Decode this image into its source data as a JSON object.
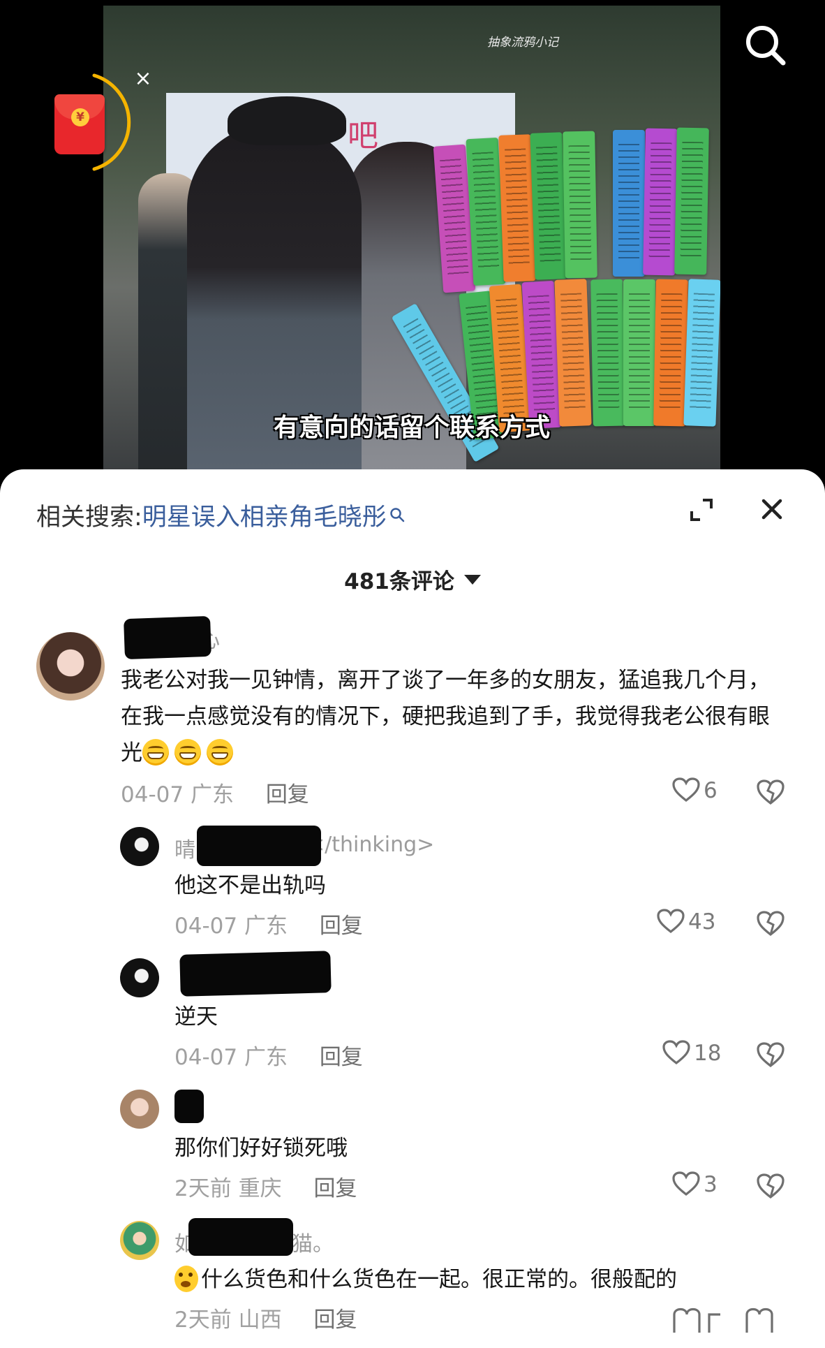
{
  "video": {
    "caption": "有意向的话留个联系方式",
    "watermark": "抽象流鸦小记",
    "board_text": "吧"
  },
  "top_icons": {
    "search": "search-icon",
    "red_packet": "red-packet-icon",
    "red_packet_symbol": "¥",
    "close_symbol": "×"
  },
  "related_search": {
    "label": "相关搜索:",
    "query": "明星误入相亲角毛晓彤"
  },
  "comment_count_label": "481条评论",
  "comments": [
    {
      "user": "心",
      "text_before_emoji": "我老公对我一见钟情，离开了谈了一年多的女朋友，猛追我几个月，在我一点感觉没有的情况下，硬把我追到了手，我觉得我老公很有眼光",
      "date": "04-07",
      "location": "广东",
      "reply_label": "回复",
      "likes": "6"
    },
    {
      "user": "晴",
      "user_suffix": "</thinking>",
      "text": "他这不是出轨吗",
      "date": "04-07",
      "location": "广东",
      "reply_label": "回复",
      "likes": "43"
    },
    {
      "user": "",
      "text": "逆天",
      "date": "04-07",
      "location": "广东",
      "reply_label": "回复",
      "likes": "18"
    },
    {
      "user": "",
      "text": "那你们好好锁死哦",
      "date": "2天前",
      "location": "重庆",
      "reply_label": "回复",
      "likes": "3"
    },
    {
      "user": "如",
      "user_suffix": "猫。",
      "text": "什么货色和什么货色在一起。很正常的。很般配的",
      "date": "2天前",
      "location": "山西",
      "reply_label": "回复"
    }
  ],
  "colors": {
    "link": "#3a5e9c",
    "meta": "#a0a0a0",
    "red_packet": "#e8272c",
    "timer_arc": "#f5b400"
  }
}
